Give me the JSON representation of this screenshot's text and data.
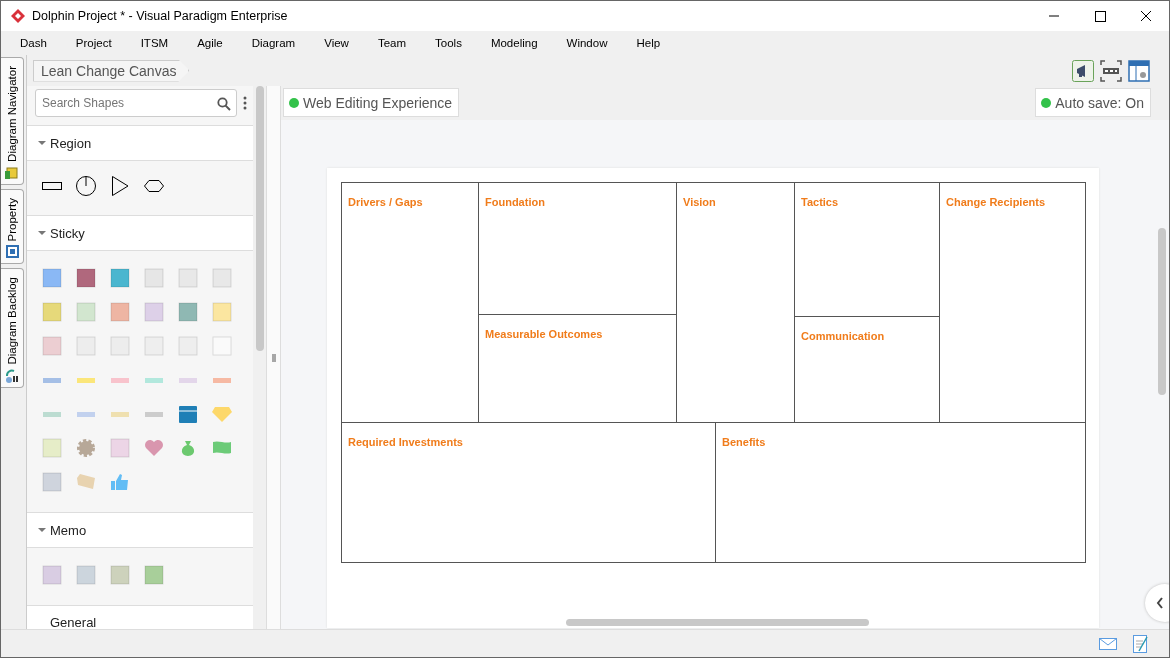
{
  "window": {
    "title": "Dolphin Project * - Visual Paradigm Enterprise"
  },
  "menu": [
    "Dash",
    "Project",
    "ITSM",
    "Agile",
    "Diagram",
    "View",
    "Team",
    "Tools",
    "Modeling",
    "Window",
    "Help"
  ],
  "side_tabs": [
    "Diagram Navigator",
    "Property",
    "Diagram Backlog"
  ],
  "breadcrumb": "Lean Change Canvas",
  "search": {
    "placeholder": "Search Shapes"
  },
  "shape_groups": [
    {
      "title": "Region",
      "expanded": true,
      "kind": "region"
    },
    {
      "title": "Sticky",
      "expanded": true,
      "kind": "sticky"
    },
    {
      "title": "Memo",
      "expanded": true,
      "kind": "memo"
    },
    {
      "title": "General",
      "kind": "general"
    }
  ],
  "badges": [
    {
      "label": "Web Editing Experience",
      "color": "#33c24a"
    },
    {
      "label": "Auto save: On",
      "color": "#33c24a"
    }
  ],
  "canvas": {
    "columns": [
      {
        "blocks": [
          "Drivers / Gaps"
        ]
      },
      {
        "blocks": [
          "Foundation",
          "Measurable Outcomes"
        ]
      },
      {
        "blocks": [
          "Vision"
        ]
      },
      {
        "blocks": [
          "Tactics",
          "Communication"
        ]
      },
      {
        "blocks": [
          "Change Recipients"
        ]
      }
    ],
    "bottom": [
      "Required Investments",
      "Benefits"
    ]
  }
}
